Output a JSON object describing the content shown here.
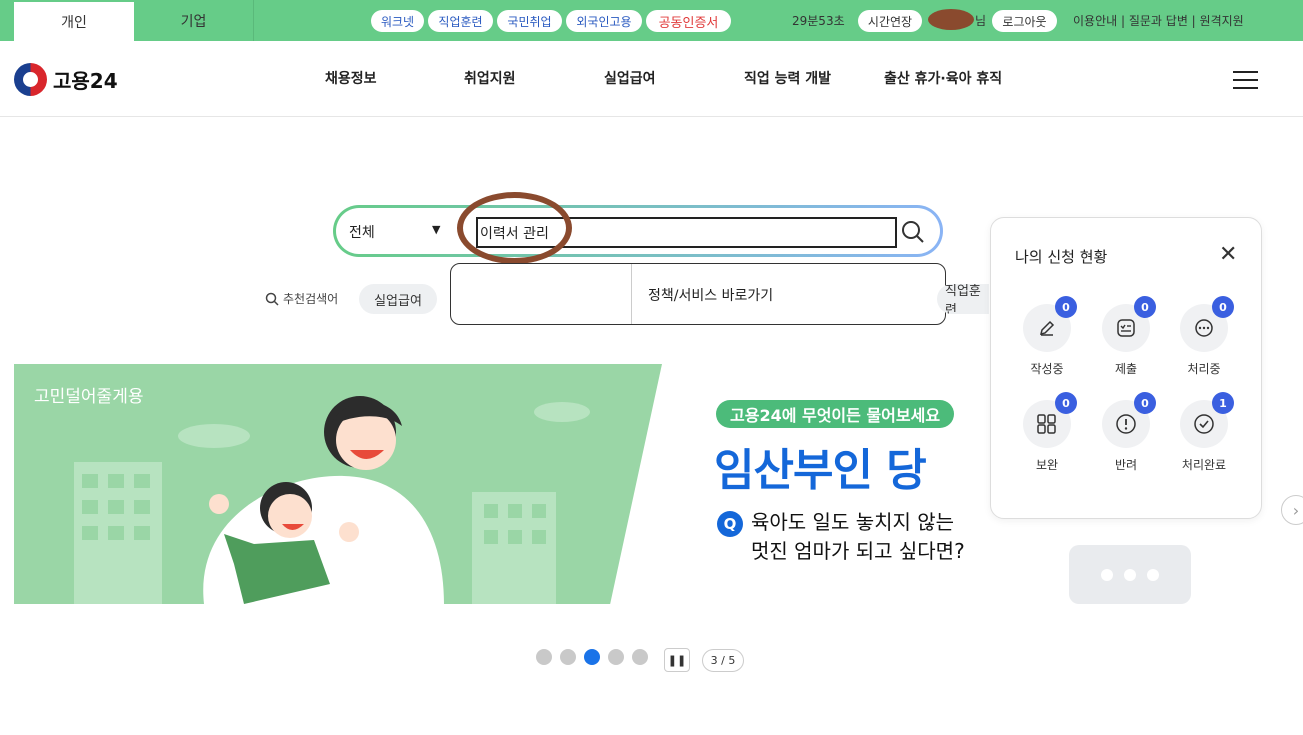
{
  "topbar": {
    "tabs": [
      "개인",
      "기업"
    ],
    "quick_links": [
      "워크넷",
      "직업훈련",
      "국민취업",
      "외국인고용",
      "공동인증서"
    ],
    "timer": "29분53초",
    "extend_label": "시간연장",
    "name_suffix": "님",
    "logout_label": "로그아웃",
    "links": [
      "이용안내",
      "질문과 답변",
      "원격지원"
    ],
    "link_sep": " | "
  },
  "header": {
    "logo_text": "고용24",
    "nav": [
      "채용정보",
      "취업지원",
      "실업급여",
      "직업 능력 개발",
      "출산 휴가·육아 휴직"
    ]
  },
  "search": {
    "category": "전체",
    "value": "이력서 관리",
    "dropdown_text": "정책/서비스 바로가기",
    "recommend_label": "추천검색어",
    "chips": [
      "실업급여",
      "직업훈련"
    ]
  },
  "banner": {
    "corner_title": "고민덜어줄게용",
    "question_badge": "고용24에 무엇이든 물어보세요",
    "headline": "임산부인 당",
    "q_mark": "Q",
    "q_line1": "육아도 일도 놓치지 않는",
    "q_line2": "멋진 엄마가 되고 싶다면?",
    "pager": "3 / 5",
    "current_slide": 3,
    "total_slides": 5
  },
  "status_panel": {
    "title": "나의 신청 현황",
    "items": [
      {
        "label": "작성중",
        "count": "0",
        "icon": "pencil-icon"
      },
      {
        "label": "제출",
        "count": "0",
        "icon": "checklist-icon"
      },
      {
        "label": "처리중",
        "count": "0",
        "icon": "ellipsis-icon"
      },
      {
        "label": "보완",
        "count": "0",
        "icon": "grid-icon"
      },
      {
        "label": "반려",
        "count": "0",
        "icon": "alert-icon"
      },
      {
        "label": "처리완료",
        "count": "1",
        "icon": "check-circle-icon"
      }
    ]
  },
  "colors": {
    "topbar": "#66cc88",
    "accent_blue": "#1467d9",
    "badge": "#3a5fe0",
    "annotation": "#8a4a2e"
  }
}
